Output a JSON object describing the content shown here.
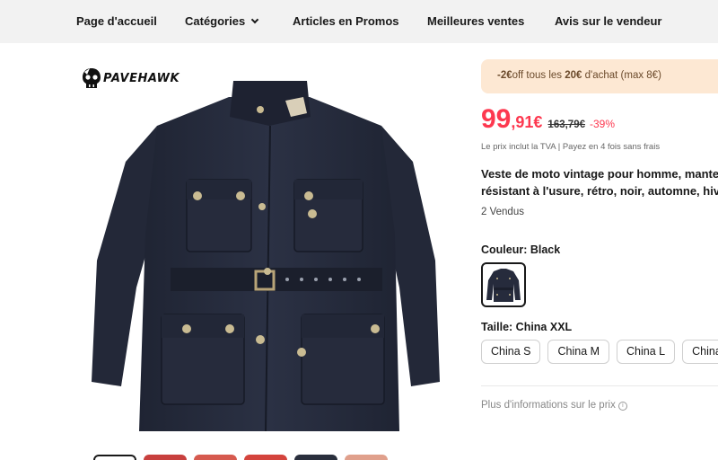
{
  "nav": {
    "home": "Page d'accueil",
    "categories": "Catégories",
    "promos": "Articles en Promos",
    "bestsellers": "Meilleures ventes",
    "seller_reviews": "Avis sur le vendeur"
  },
  "brand": {
    "name": "PAVEHAWK"
  },
  "promo": {
    "amount": "-2€",
    "text_mid": "off tous les ",
    "threshold": "20€",
    "text_end": " d'achat (max 8€)"
  },
  "price": {
    "main": "99",
    "rest": ",91€",
    "original": "163,79€",
    "discount": "-39%"
  },
  "tax_note": "Le prix inclut la TVA | Payez en 4 fois sans frais",
  "product": {
    "title": "Veste de moto vintage pour homme, manteau résistant à l'usure, rétro, noir, automne, hiver",
    "sold": "2 Vendus"
  },
  "color": {
    "label": "Couleur: Black"
  },
  "size": {
    "label": "Taille: China XXL",
    "options": [
      "China S",
      "China M",
      "China L",
      "China XL"
    ]
  },
  "more_info": "Plus d'informations sur le prix",
  "colors": {
    "accent": "#fd384f",
    "promo_bg": "#fde8d3",
    "nav_bg": "#f2f2f2",
    "jacket": "#262b3c"
  }
}
